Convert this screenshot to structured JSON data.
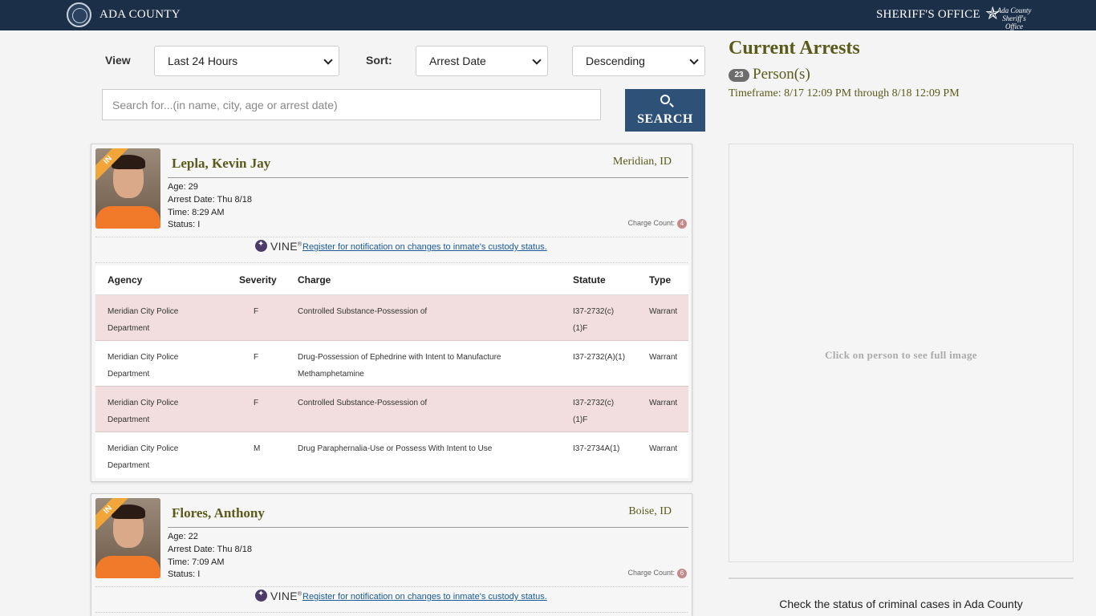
{
  "header": {
    "county": "ADA COUNTY",
    "office": "SHERIFF'S OFFICE",
    "logo_text": "Ada County Sheriff's Office"
  },
  "controls": {
    "view_label": "View",
    "view_value": "Last 24 Hours",
    "sort_label": "Sort:",
    "sort_value": "Arrest Date",
    "order_value": "Descending",
    "search_placeholder": "Search for...(in name, city, age or arrest date)",
    "search_button": "SEARCH"
  },
  "summary": {
    "title": "Current Arrests",
    "count": "23",
    "count_label": "Person(s)",
    "timeframe": "Timeframe: 8/17 12:09 PM through 8/18 12:09 PM",
    "preview_hint": "Click on person to see full image",
    "check_status": "Check the status of criminal cases in Ada County"
  },
  "colors": {
    "header_bg": "#1b2f48",
    "accent_olive": "#5a5a1a",
    "button_blue": "#2d5177",
    "row_pink": "#f2dede",
    "ribbon_orange": "#f2a63a"
  },
  "vine": {
    "brand": "VINE",
    "link": "Register for notification on changes to inmate's custody status."
  },
  "table_headers": {
    "agency": "Agency",
    "severity": "Severity",
    "charge": "Charge",
    "statute": "Statute",
    "type": "Type"
  },
  "inmates": [
    {
      "ribbon": "IN",
      "name": "Lepla, Kevin Jay",
      "city": "Meridian, ID",
      "age": "Age: 29",
      "arrest_date": "Arrest Date: Thu 8/18",
      "time": "Time: 8:29 AM",
      "status": "Status: I",
      "charge_count_label": "Charge Count:",
      "charge_count": "4",
      "charges": [
        {
          "agency": "Meridian City Police Department",
          "severity": "F",
          "charge": "Controlled Substance-Possession of",
          "statute": "I37-2732(c)(1)F",
          "type": "Warrant"
        },
        {
          "agency": "Meridian City Police Department",
          "severity": "F",
          "charge": "Drug-Possession of Ephedrine with Intent to Manufacture Methamphetamine",
          "statute": "I37-2732(A)(1)",
          "type": "Warrant"
        },
        {
          "agency": "Meridian City Police Department",
          "severity": "F",
          "charge": "Controlled Substance-Possession of",
          "statute": "I37-2732(c)(1)F",
          "type": "Warrant"
        },
        {
          "agency": "Meridian City Police Department",
          "severity": "M",
          "charge": "Drug Paraphernalia-Use or Possess With Intent to Use",
          "statute": "I37-2734A(1)",
          "type": "Warrant"
        }
      ]
    },
    {
      "ribbon": "IN",
      "name": "Flores, Anthony",
      "city": "Boise, ID",
      "age": "Age: 22",
      "arrest_date": "Arrest Date: Thu 8/18",
      "time": "Time: 7:09 AM",
      "status": "Status: I",
      "charge_count_label": "Charge Count:",
      "charge_count": "6"
    }
  ]
}
